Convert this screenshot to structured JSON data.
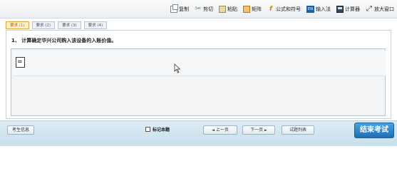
{
  "toolbar": {
    "items": [
      {
        "label": "复制",
        "icon": "copy-icon"
      },
      {
        "label": "剪切",
        "icon": "cut-icon"
      },
      {
        "label": "粘贴",
        "icon": "paste-icon"
      },
      {
        "label": "矩阵",
        "icon": "matrix-icon"
      },
      {
        "label": "公式和符号",
        "icon": "formula-icon"
      },
      {
        "label": "输入法",
        "icon": "ime-icon"
      },
      {
        "label": "计算器",
        "icon": "calculator-icon"
      },
      {
        "label": "放大窗口",
        "icon": "zoom-icon"
      }
    ]
  },
  "tabs": [
    {
      "label": "要求 (1)",
      "active": true
    },
    {
      "label": "要求 (2)",
      "active": false
    },
    {
      "label": "要求 (3)",
      "active": false
    },
    {
      "label": "要求 (4)",
      "active": false
    }
  ],
  "question": {
    "text": "1、 计算确定华兴公司购入该设备的入账价值。"
  },
  "answer": {
    "value": "="
  },
  "bottom": {
    "info_label": "考生信息",
    "mark_label": "标记本题",
    "prev_label": "上一页",
    "next_label": "下一页",
    "list_label": "试题列表",
    "end_label": "结束考试",
    "prev_arrow": "◄",
    "next_arrow": "►"
  },
  "colors": {
    "accent": "#1b6fb4",
    "tab_active": "#e0a43a"
  }
}
